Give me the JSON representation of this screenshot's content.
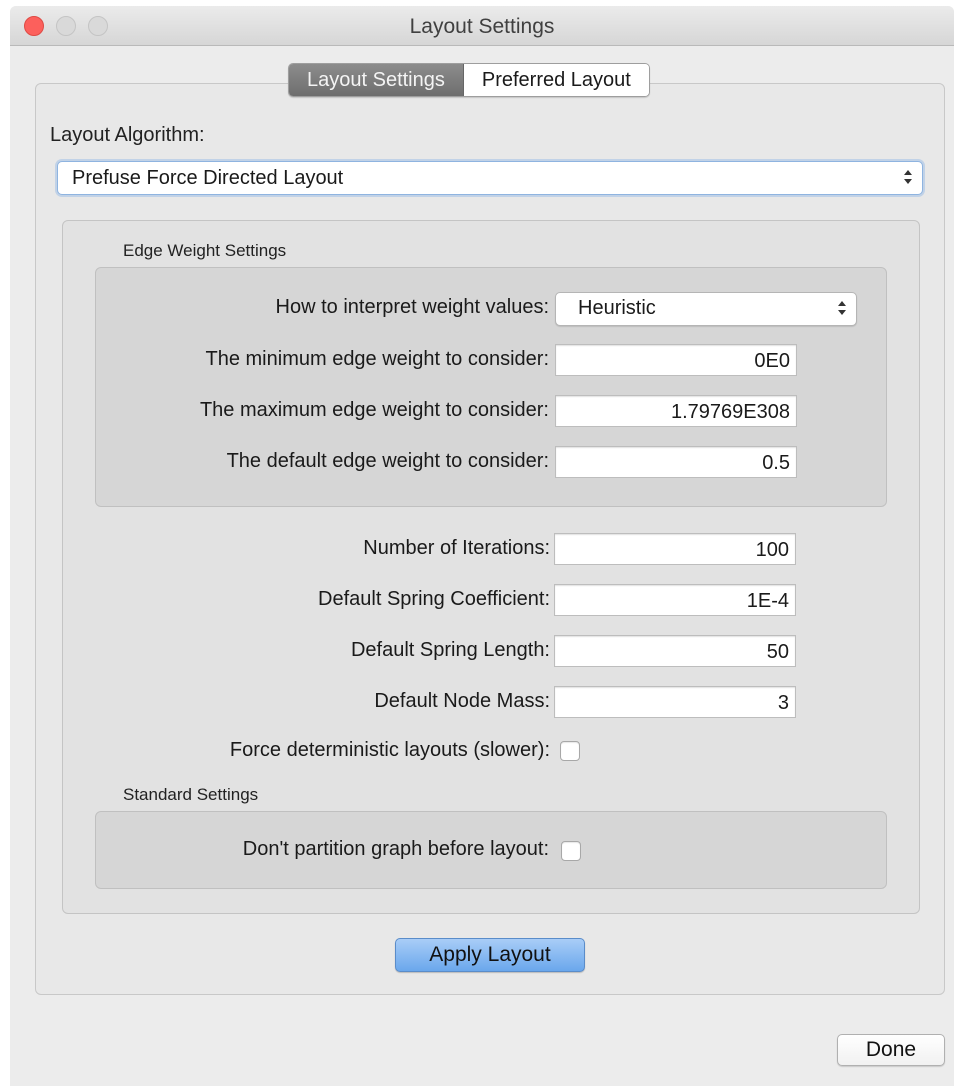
{
  "window": {
    "title": "Layout Settings",
    "buttons": [
      "close",
      "minimize",
      "zoom"
    ]
  },
  "tabs": [
    {
      "label": "Layout Settings",
      "selected": true
    },
    {
      "label": "Preferred Layout",
      "selected": false
    }
  ],
  "layout_algorithm": {
    "label": "Layout Algorithm:",
    "selected": "Prefuse Force Directed Layout"
  },
  "edge_weight_settings": {
    "title": "Edge Weight Settings",
    "interpret_label": "How to interpret weight values:",
    "interpret_value": "Heuristic",
    "min_label": "The minimum edge weight to consider:",
    "min_value": "0E0",
    "max_label": "The maximum edge weight to consider:",
    "max_value": "1.79769E308",
    "default_label": "The default edge weight to consider:",
    "default_value": "0.5"
  },
  "algorithm_settings": {
    "iterations_label": "Number of Iterations:",
    "iterations_value": "100",
    "spring_coeff_label": "Default Spring Coefficient:",
    "spring_coeff_value": "1E-4",
    "spring_length_label": "Default Spring Length:",
    "spring_length_value": "50",
    "node_mass_label": "Default Node Mass:",
    "node_mass_value": "3",
    "deterministic_label": "Force deterministic layouts (slower):",
    "deterministic_checked": false
  },
  "standard_settings": {
    "title": "Standard Settings",
    "partition_label": "Don't partition graph before layout:",
    "partition_checked": false
  },
  "actions": {
    "apply_label": "Apply Layout",
    "done_label": "Done"
  },
  "colors": {
    "close_button": "#fc605c",
    "primary_button": "#6aa7ec",
    "selected_tab": "#7a7a7a"
  }
}
